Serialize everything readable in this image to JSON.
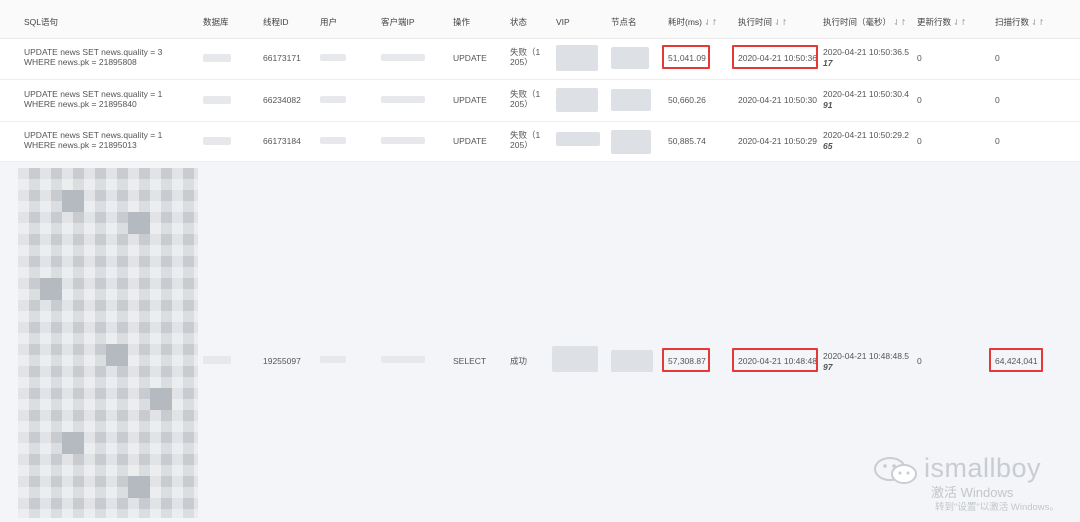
{
  "headers": {
    "sql": "SQL语句",
    "db": "数据库",
    "thread_id": "线程ID",
    "user": "用户",
    "client_ip": "客户端IP",
    "operation": "操作",
    "status": "状态",
    "vip": "VIP",
    "node": "节点名",
    "elapsed": "耗时(ms)",
    "exec_time": "执行时间",
    "exec_time_ms": "执行时间（毫秒）",
    "updated_rows": "更新行数",
    "scanned_rows": "扫描行数"
  },
  "sort_icon": "sort-icon",
  "rows": [
    {
      "sql": "UPDATE news SET news.quality = 3 WHERE news.pk = 21895808",
      "thread_id": "66173171",
      "operation": "UPDATE",
      "status": "失败（1 205）",
      "elapsed": "51,041.09",
      "exec_time": "2020-04-21 10:50:36",
      "exec_time_ms": "2020-04-21 10:50:36.5",
      "exec_time_ms_frac": "17",
      "updated_rows": "0",
      "scanned_rows": "0"
    },
    {
      "sql": "UPDATE news SET news.quality = 1 WHERE news.pk = 21895840",
      "thread_id": "66234082",
      "operation": "UPDATE",
      "status": "失败（1 205）",
      "elapsed": "50,660.26",
      "exec_time": "2020-04-21 10:50:30",
      "exec_time_ms": "2020-04-21 10:50:30.4",
      "exec_time_ms_frac": "91",
      "updated_rows": "0",
      "scanned_rows": "0"
    },
    {
      "sql": "UPDATE news SET news.quality = 1 WHERE news.pk = 21895013",
      "thread_id": "66173184",
      "operation": "UPDATE",
      "status": "失败（1 205）",
      "elapsed": "50,885.74",
      "exec_time": "2020-04-21 10:50:29",
      "exec_time_ms": "2020-04-21 10:50:29.2",
      "exec_time_ms_frac": "65",
      "updated_rows": "0",
      "scanned_rows": "0"
    },
    {
      "sql": "",
      "thread_id": "19255097",
      "operation": "SELECT",
      "status": "成功",
      "elapsed": "57,308.87",
      "exec_time": "2020-04-21 10:48:48",
      "exec_time_ms": "2020-04-21 10:48:48.5",
      "exec_time_ms_frac": "97",
      "updated_rows": "0",
      "scanned_rows": "64,424,041"
    }
  ],
  "watermark": {
    "brand": "ismallboy",
    "activate_title": "激活 Windows",
    "activate_hint": "转到\"设置\"以激活 Windows。"
  },
  "highlight_color": "#e53935"
}
